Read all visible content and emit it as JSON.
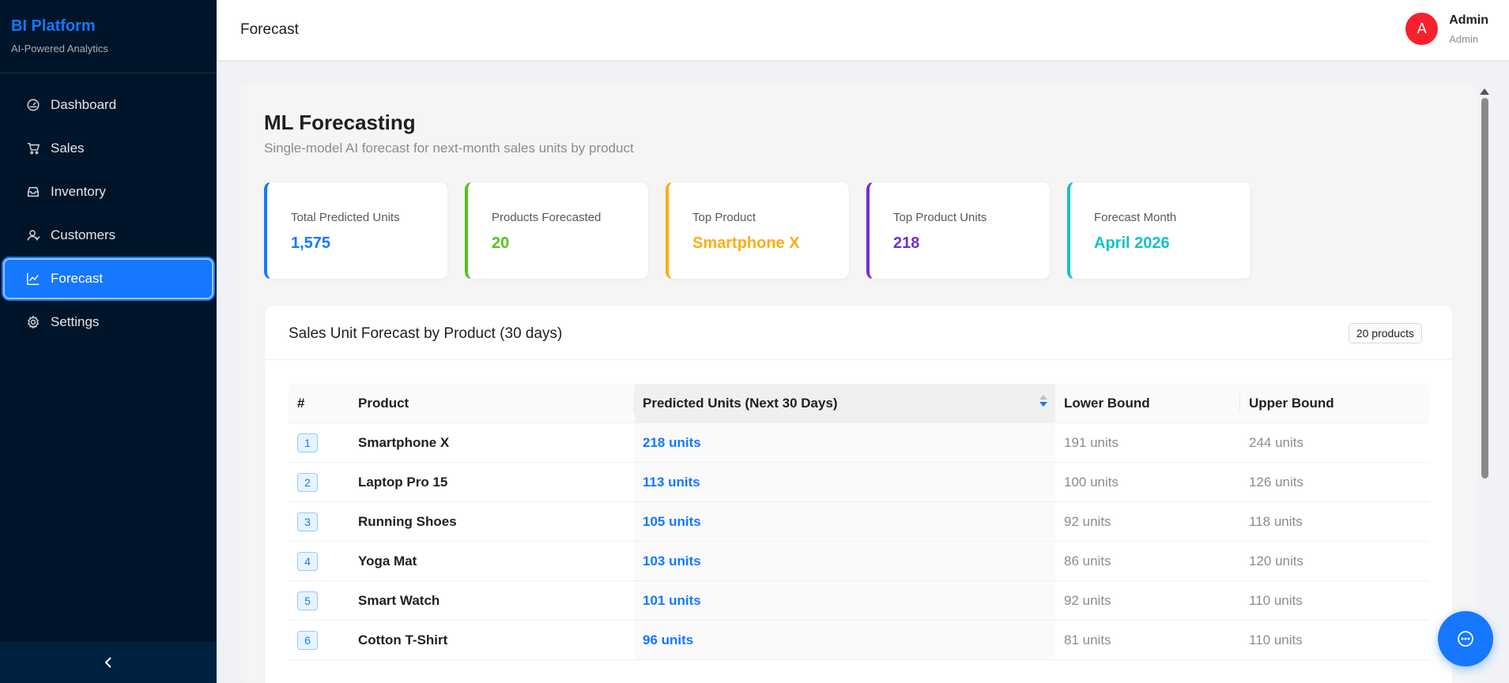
{
  "brand": {
    "title": "BI Platform",
    "subtitle": "AI-Powered Analytics"
  },
  "sidebar": {
    "items": [
      {
        "label": "Dashboard",
        "icon": "dashboard-icon",
        "active": false
      },
      {
        "label": "Sales",
        "icon": "cart-icon",
        "active": false
      },
      {
        "label": "Inventory",
        "icon": "inbox-icon",
        "active": false
      },
      {
        "label": "Customers",
        "icon": "user-icon",
        "active": false
      },
      {
        "label": "Forecast",
        "icon": "line-chart-icon",
        "active": true
      },
      {
        "label": "Settings",
        "icon": "gear-icon",
        "active": false
      }
    ]
  },
  "header": {
    "title": "Forecast",
    "user": {
      "initial": "A",
      "name": "Admin",
      "role": "Admin"
    }
  },
  "main": {
    "title": "ML Forecasting",
    "subtitle": "Single-model AI forecast for next-month sales units by product",
    "stats": [
      {
        "label": "Total Predicted Units",
        "value": "1,575",
        "color": "#1677ff"
      },
      {
        "label": "Products Forecasted",
        "value": "20",
        "color": "#52c41a"
      },
      {
        "label": "Top Product",
        "value": "Smartphone X",
        "color": "#faad14"
      },
      {
        "label": "Top Product Units",
        "value": "218",
        "color": "#722ed1"
      },
      {
        "label": "Forecast Month",
        "value": "April 2026",
        "color": "#13c2c2"
      }
    ],
    "table": {
      "title": "Sales Unit Forecast by Product (30 days)",
      "badge": "20 products",
      "columns": [
        "#",
        "Product",
        "Predicted Units (Next 30 Days)",
        "Lower Bound",
        "Upper Bound"
      ],
      "rows": [
        {
          "rank": "1",
          "product": "Smartphone X",
          "predicted": "218 units",
          "lower": "191 units",
          "upper": "244 units"
        },
        {
          "rank": "2",
          "product": "Laptop Pro 15",
          "predicted": "113 units",
          "lower": "100 units",
          "upper": "126 units"
        },
        {
          "rank": "3",
          "product": "Running Shoes",
          "predicted": "105 units",
          "lower": "92 units",
          "upper": "118 units"
        },
        {
          "rank": "4",
          "product": "Yoga Mat",
          "predicted": "103 units",
          "lower": "86 units",
          "upper": "120 units"
        },
        {
          "rank": "5",
          "product": "Smart Watch",
          "predicted": "101 units",
          "lower": "92 units",
          "upper": "110 units"
        },
        {
          "rank": "6",
          "product": "Cotton T-Shirt",
          "predicted": "96 units",
          "lower": "81 units",
          "upper": "110 units"
        }
      ]
    }
  }
}
